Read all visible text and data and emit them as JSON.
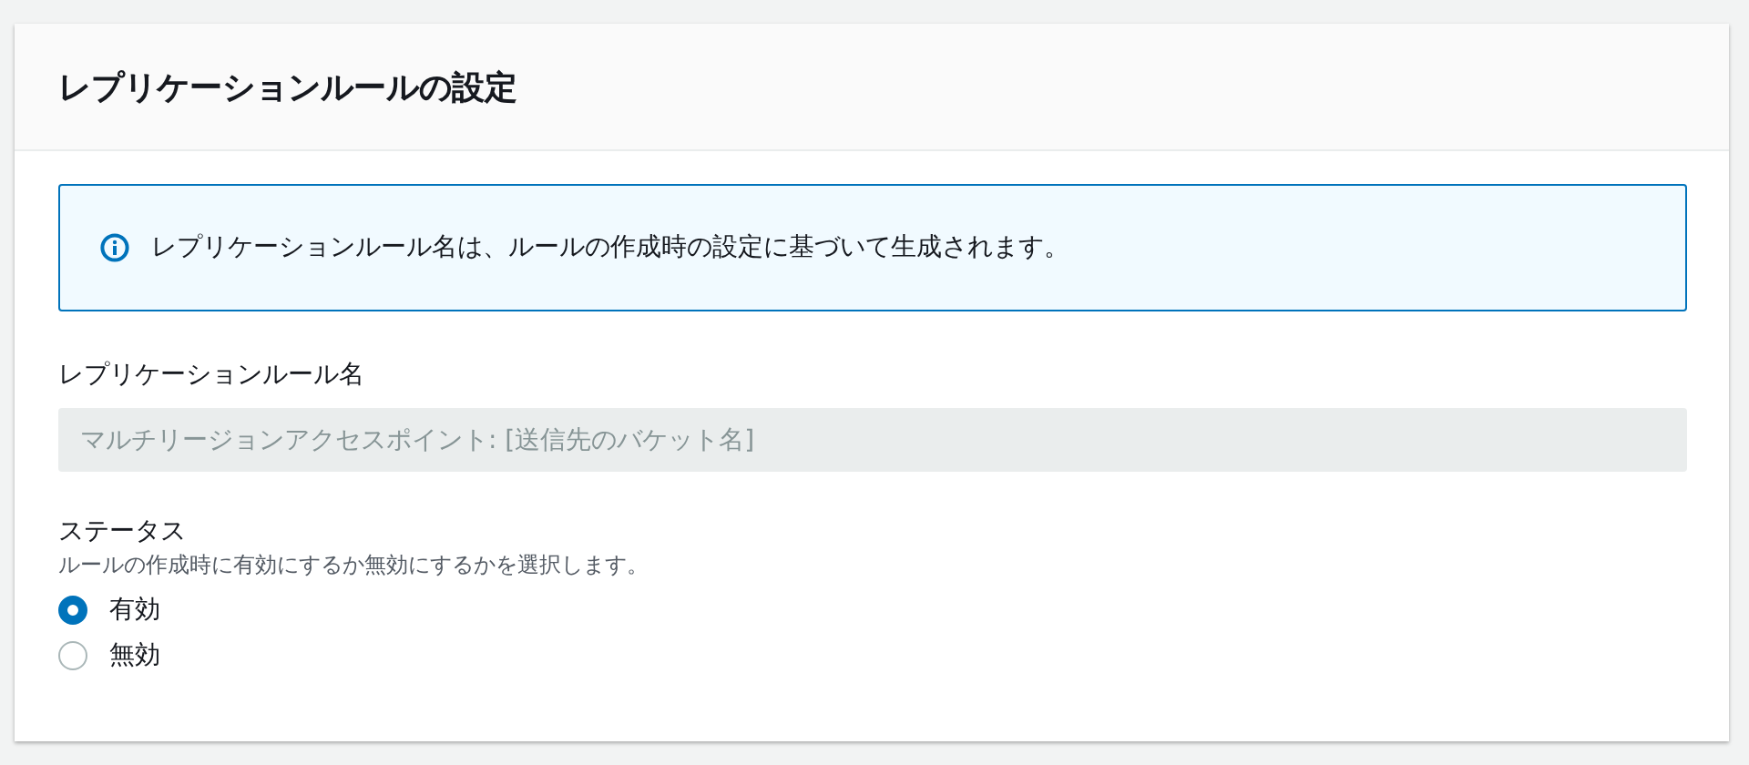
{
  "panel": {
    "title": "レプリケーションルールの設定"
  },
  "info_alert": {
    "text": "レプリケーションルール名は、ルールの作成時の設定に基づいて生成されます。"
  },
  "rule_name": {
    "label": "レプリケーションルール名",
    "placeholder": "マルチリージョンアクセスポイント: [送信先のバケット名]",
    "disabled": true
  },
  "status": {
    "label": "ステータス",
    "description": "ルールの作成時に有効にするか無効にするかを選択します。",
    "options": [
      {
        "label": "有効",
        "selected": true
      },
      {
        "label": "無効",
        "selected": false
      }
    ]
  }
}
